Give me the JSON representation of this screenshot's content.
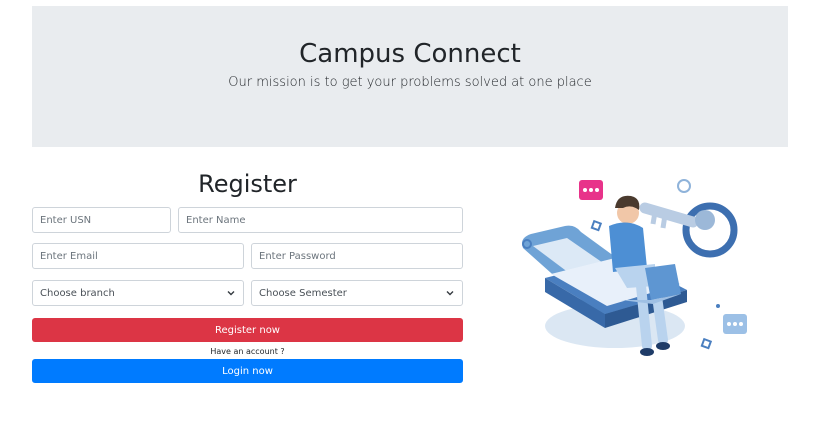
{
  "header": {
    "title": "Campus Connect",
    "subtitle": "Our mission is to get your problems solved at one place"
  },
  "register": {
    "title": "Register",
    "usn_placeholder": "Enter USN",
    "name_placeholder": "Enter Name",
    "email_placeholder": "Enter Email",
    "password_placeholder": "Enter Password",
    "branch_selected": "Choose branch",
    "semester_selected": "Choose Semester",
    "register_button": "Register now",
    "have_account": "Have an account ?",
    "login_button": "Login now"
  },
  "colors": {
    "jumbotron_bg": "#e9ecef",
    "danger": "#dc3545",
    "primary": "#007bff"
  },
  "icons": {
    "select_arrow": "chevron-down-icon",
    "illustration": "student-laptop-key-illustration"
  }
}
